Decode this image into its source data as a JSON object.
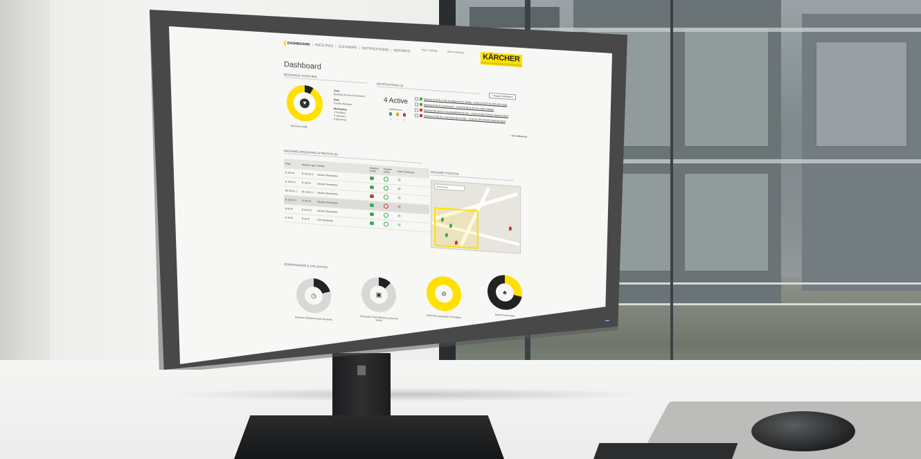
{
  "nav": {
    "items": [
      "DASHBOARD",
      "FACILITIES",
      "CLEANERS",
      "NOTIFICATIONS",
      "REPORTS"
    ],
    "active": "DASHBOARD"
  },
  "header": {
    "help": "Help / Settings",
    "user": "Admin Derbund",
    "logo": "KÄRCHER"
  },
  "page_title": "Dashboard",
  "resource_overview": {
    "heading": "RESOURCE OVERVIEW",
    "health_label": "Machine health",
    "view_label": "View",
    "view_value": "Building Service Contractors",
    "role_label": "Role",
    "role_value": "Facility Manager",
    "monitoring_label": "Monitoring",
    "monitoring": [
      "2   Facilities",
      "6   Cleaners",
      "8   Machines"
    ],
    "active": "4 Active",
    "notifications_label": "Notifications",
    "notification_counts": [
      "2",
      "1",
      "2"
    ]
  },
  "notifications": {
    "heading": "NOTIFICATIONS (4)",
    "accept_button": "+ Accept Notification",
    "items": [
      "Machine B 40 W C rate is assigned from facility - 14:03:16 2017-02-08 | A03 Class",
      "Machine B 40 W is belowrater - 13:58:35 08:12:19 rule | A03 Gulasch",
      "Machine BR 35/12 C has deadlocked its rate - 14:03:14 2017:09:03 | Machine 6014",
      "Machine B 150 W C has desk-rater to fate - 14:03:16 2017:09:03 | Machine 6014"
    ],
    "more": "> all notifications"
  },
  "attention_table": {
    "heading": "MACHINES REQUIRING ATTENTION (6)",
    "columns": [
      "Alias",
      "Machine type",
      "Facility",
      "Machine health",
      "Position status",
      "Data Timeliness"
    ],
    "rows": [
      {
        "alias": "B 150 W",
        "type": "B 150 W S",
        "facility": "Kärcher Winnenden",
        "health": "ok",
        "position": "ok",
        "data": "ok"
      },
      {
        "alias": "B 150 S C",
        "type": "B 150 W",
        "facility": "Kärcher Winnenden",
        "health": "ok",
        "position": "ok",
        "data": "ok"
      },
      {
        "alias": "BD 50/12 C",
        "type": "BD 38/12 C",
        "facility": "Kärcher Winnenden",
        "health": "alert",
        "position": "ok",
        "data": "ok"
      },
      {
        "alias": "B 150 W C",
        "type": "B 150 W",
        "facility": "Kärcher Winnenden",
        "health": "ok",
        "position": "alert",
        "data": "alert"
      },
      {
        "alias": "B 60 W",
        "type": "B 60 W S",
        "facility": "Kärcher Winnenden",
        "health": "ok",
        "position": "ok",
        "data": "ok"
      },
      {
        "alias": "B 40 W",
        "type": "B 40 W",
        "facility": "U03 Vertebrate",
        "health": "ok",
        "position": "ok",
        "data": "ok"
      }
    ]
  },
  "map": {
    "heading": "MACHINE POSITION",
    "select": "All Machines"
  },
  "performance": {
    "heading": "PERFORMANCE & UTILIZATION",
    "gauges": [
      {
        "label": "Machine Utilization (last full week)",
        "value": 0.2,
        "color": "#222222",
        "track": "#d8d8d6"
      },
      {
        "label": "Scheduled Start Efficiency (last full week)",
        "value": 0.12,
        "color": "#222222",
        "track": "#d8d8d6"
      },
      {
        "label": "Machines assigned to Facilities",
        "value": 1.0,
        "color": "#ffe000",
        "track": "#ffe000"
      },
      {
        "label": "Departments data",
        "value": 0.28,
        "color": "#ffe000",
        "track": "#222222"
      }
    ]
  },
  "colors": {
    "brand_yellow": "#ffe000",
    "ok_green": "#3aa84a",
    "alert_red": "#d0342c"
  }
}
